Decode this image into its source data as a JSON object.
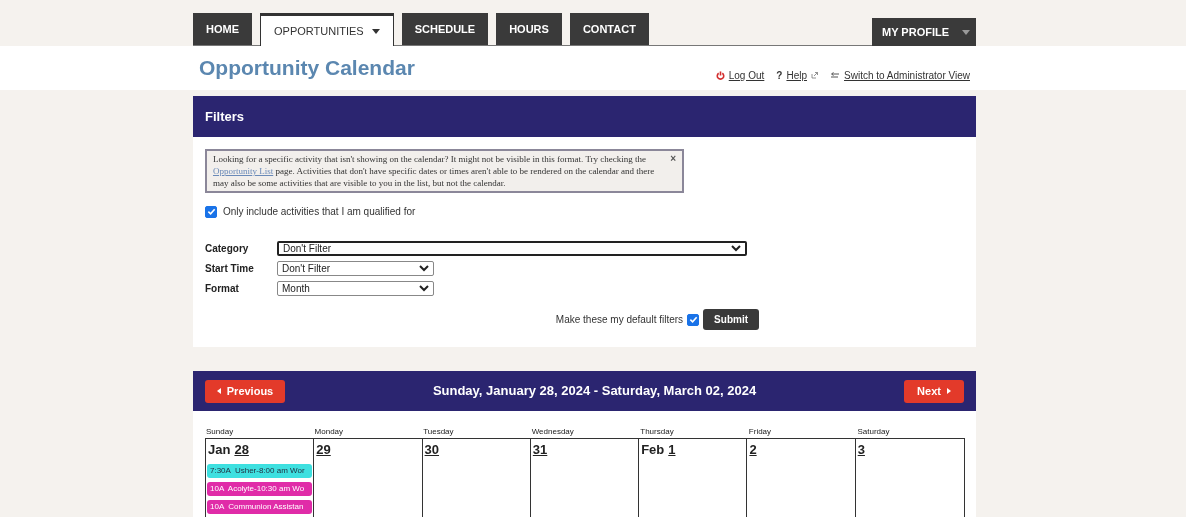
{
  "nav": {
    "tabs": [
      {
        "label": "HOME",
        "selected": false,
        "dropdown": false
      },
      {
        "label": "OPPORTUNITIES",
        "selected": true,
        "dropdown": true
      },
      {
        "label": "SCHEDULE",
        "selected": false,
        "dropdown": false
      },
      {
        "label": "HOURS",
        "selected": false,
        "dropdown": false
      },
      {
        "label": "CONTACT",
        "selected": false,
        "dropdown": false
      }
    ],
    "profile": {
      "label": "MY PROFILE"
    }
  },
  "header": {
    "title": "Opportunity Calendar",
    "links": [
      {
        "kind": "logout",
        "label": "Log Out"
      },
      {
        "kind": "help",
        "label": "Help",
        "icon": "?"
      },
      {
        "kind": "switch",
        "label": "Switch to Administrator View"
      }
    ]
  },
  "filters": {
    "title": "Filters",
    "notice": {
      "before": "Looking for a specific activity that isn't showing on the calendar? It might not be visible in this format. Try checking the",
      "link": "Opportunity List",
      "after": "page. Activities that don't have specific dates or times aren't able to be rendered on the calendar and there may also be some activities that are visible to you in the list, but not the calendar.",
      "close": "×"
    },
    "qualified": {
      "label": "Only include activities that I am qualified for",
      "checked": true
    },
    "fields": [
      {
        "label": "Category",
        "value": "Don't Filter",
        "wide": true
      },
      {
        "label": "Start Time",
        "value": "Don't Filter",
        "wide": false
      },
      {
        "label": "Format",
        "value": "Month",
        "wide": false
      }
    ],
    "default": {
      "label": "Make these my default filters",
      "checked": true
    },
    "submit": "Submit"
  },
  "calendar": {
    "previous": "Previous",
    "next": "Next",
    "range": "Sunday, January 28, 2024 - Saturday, March 02, 2024",
    "weekdays": [
      "Sunday",
      "Monday",
      "Tuesday",
      "Wednesday",
      "Thursday",
      "Friday",
      "Saturday"
    ],
    "days": [
      {
        "month": "Jan",
        "day": "28",
        "events": [
          {
            "text": "7:30A  Usher-8:00 am Wor",
            "color": "#3ee0e0"
          },
          {
            "text": "10A  Acolyte-10:30 am Wo",
            "color": "#e02ca8"
          },
          {
            "text": "10A  Communion Assistan",
            "color": "#e02ca8"
          }
        ]
      },
      {
        "day": "29"
      },
      {
        "day": "30"
      },
      {
        "day": "31"
      },
      {
        "month": "Feb",
        "day": "1"
      },
      {
        "day": "2"
      },
      {
        "day": "3"
      }
    ]
  }
}
